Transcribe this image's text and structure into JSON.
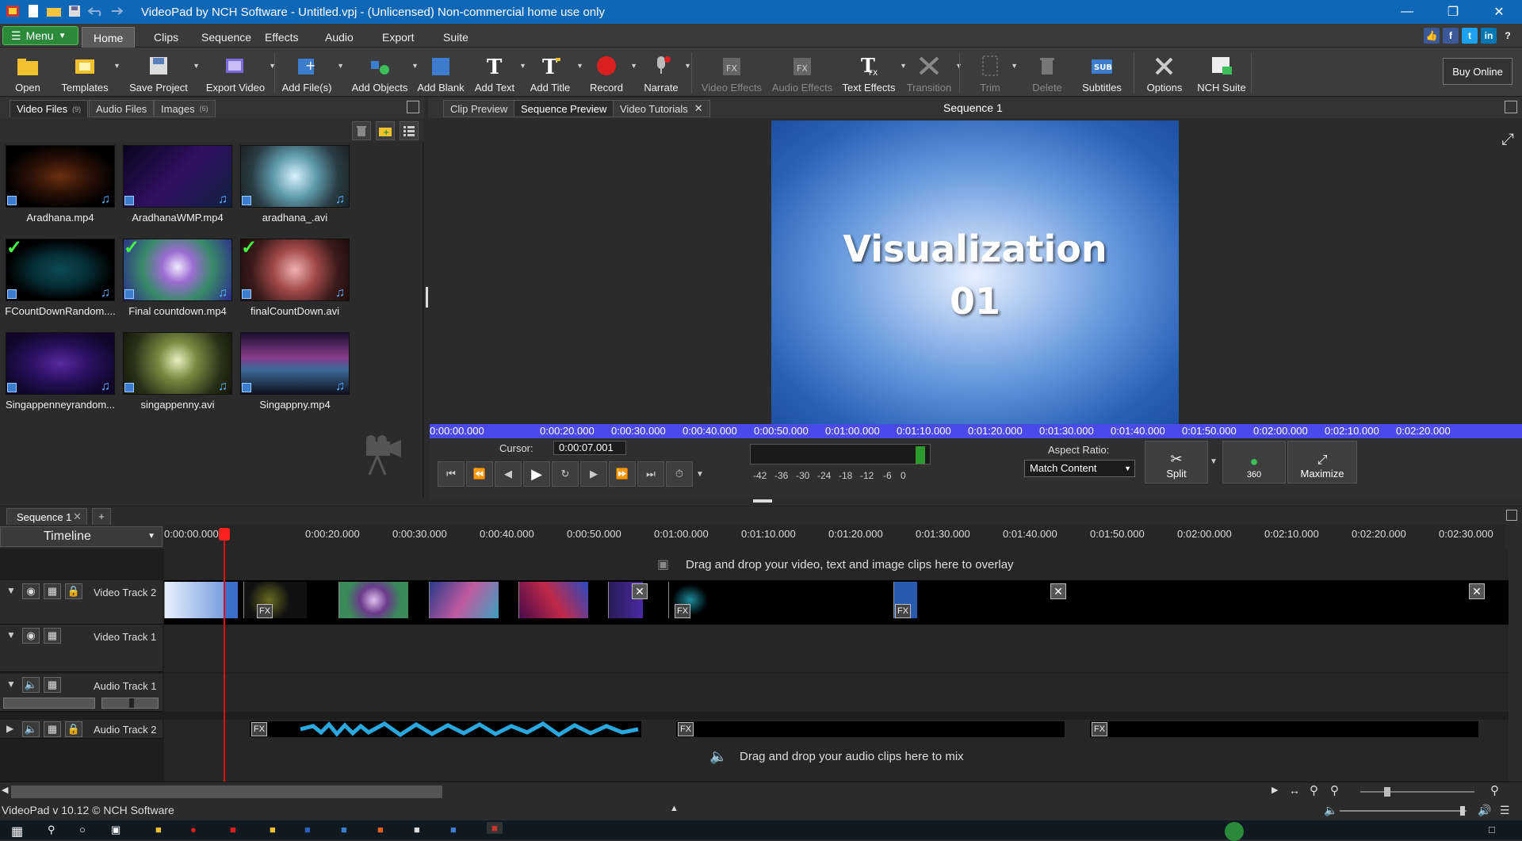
{
  "window": {
    "title": "VideoPad by NCH Software - Untitled.vpj - (Unlicensed) Non-commercial home use only"
  },
  "menubar": {
    "menu_label": "Menu",
    "tabs": [
      "Home",
      "Clips",
      "Sequence",
      "Effects",
      "Audio",
      "Export",
      "Suite"
    ],
    "active_tab": "Home"
  },
  "toolbar": {
    "buttons": [
      "Open",
      "Templates",
      "Save Project",
      "Export Video",
      "Add File(s)",
      "Add Objects",
      "Add Blank",
      "Add Text",
      "Add Title",
      "Record",
      "Narrate",
      "Video Effects",
      "Audio Effects",
      "Text Effects",
      "Transition",
      "Trim",
      "Delete",
      "Subtitles",
      "Options",
      "NCH Suite"
    ],
    "buy_online": "Buy Online"
  },
  "bin": {
    "tabs": [
      {
        "label": "Video Files",
        "count": "(9)"
      },
      {
        "label": "Audio Files",
        "count": ""
      },
      {
        "label": "Images",
        "count": "(6)"
      }
    ],
    "files": [
      "Aradhana.mp4",
      "AradhanaWMP.mp4",
      "aradhana_.avi",
      "FCountDownRandom....",
      "Final countdown.mp4",
      "finalCountDown.avi",
      "Singappenneyrandom...",
      "singappenny.avi",
      "Singappny.mp4"
    ]
  },
  "preview": {
    "tabs": [
      "Clip Preview",
      "Sequence Preview",
      "Video Tutorials"
    ],
    "active_tab": "Sequence Preview",
    "sequence_title": "Sequence 1",
    "screen_text_line1": "Visualization",
    "screen_text_line2": "01",
    "ruler_labels": [
      "0:00:00.000",
      "0:00:20.000",
      "0:00:30.000",
      "0:00:40.000",
      "0:00:50.000",
      "0:01:00.000",
      "0:01:10.000",
      "0:01:20.000",
      "0:01:30.000",
      "0:01:40.000",
      "0:01:50.000",
      "0:02:00.000",
      "0:02:10.000",
      "0:02:20.000"
    ],
    "cursor_label": "Cursor:",
    "cursor_value": "0:00:07.001",
    "meter_labels": [
      "-42",
      "-36",
      "-30",
      "-24",
      "-18",
      "-12",
      "-6",
      "0"
    ],
    "aspect_label": "Aspect Ratio:",
    "aspect_value": "Match Content",
    "split_label": "Split",
    "btn360_label": "360",
    "maximize_label": "Maximize"
  },
  "sequence": {
    "tab_label": "Sequence 1",
    "add_tab": "+"
  },
  "timeline": {
    "selector_label": "Timeline",
    "ruler_labels": [
      "0:00:00.000",
      "0:00:20.000",
      "0:00:30.000",
      "0:00:40.000",
      "0:00:50.000",
      "0:01:00.000",
      "0:01:10.000",
      "0:01:20.000",
      "0:01:30.000",
      "0:01:40.000",
      "0:01:50.000",
      "0:02:00.000",
      "0:02:10.000",
      "0:02:20.000",
      "0:02:30.000"
    ],
    "overlay_msg": "Drag and drop your video, text and image clips here to overlay",
    "audio_msg": "Drag and drop your audio clips here to mix",
    "tracks": [
      "Video Track 2",
      "Video Track 1",
      "Audio Track 1",
      "Audio Track 2"
    ],
    "fx_label": "FX"
  },
  "status": {
    "version": "VideoPad v 10.12 © NCH Software"
  },
  "colors": {
    "titlebar": "#0f67b8",
    "accent_green": "#2a8a3a",
    "ruler_blue": "#4a4aea",
    "playhead": "#e01010",
    "waveform": "#29a8e0"
  }
}
